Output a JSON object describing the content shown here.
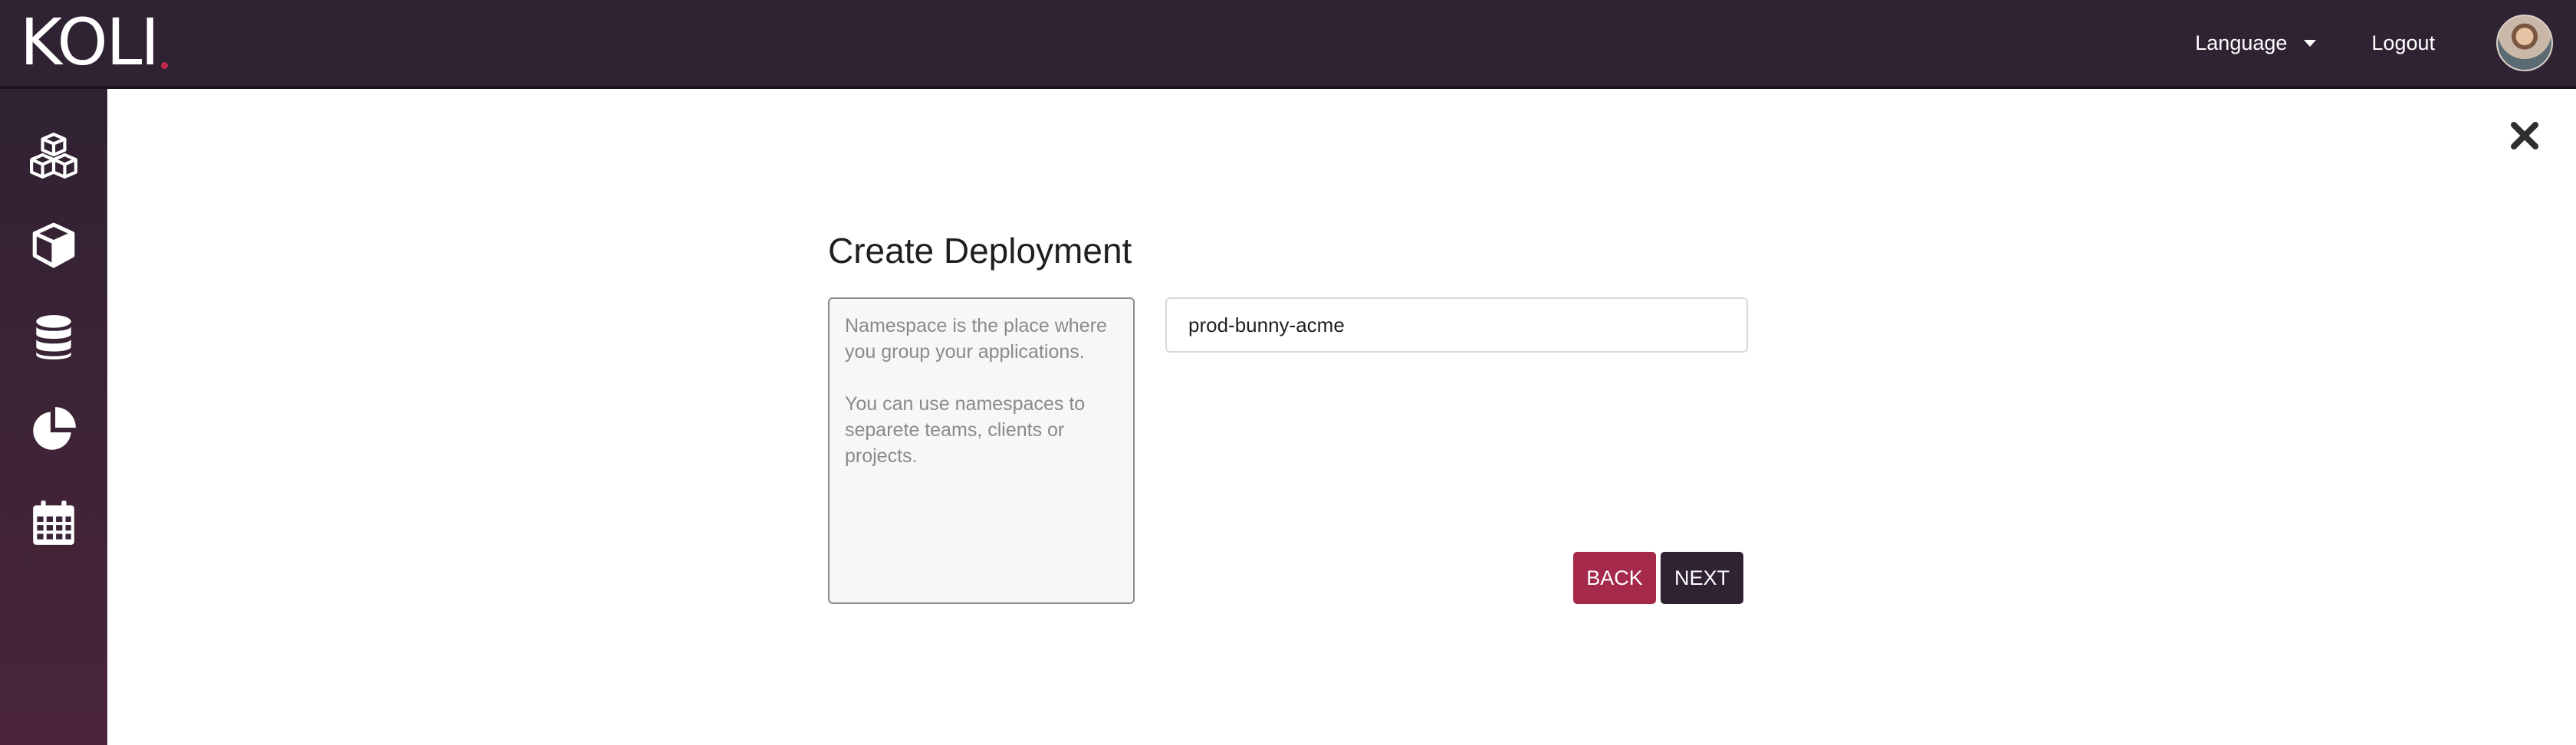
{
  "header": {
    "logo_text": "KOLI",
    "language_label": "Language",
    "logout_label": "Logout"
  },
  "sidebar": {
    "items": [
      {
        "icon": "cubes-icon"
      },
      {
        "icon": "cube-icon"
      },
      {
        "icon": "database-icon"
      },
      {
        "icon": "pie-chart-icon"
      },
      {
        "icon": "calendar-icon"
      }
    ]
  },
  "main": {
    "title": "Create Deployment",
    "help_text_1": "Namespace is the place where you group your applications.",
    "help_text_2": "You can use namespaces to separete teams, clients or projects.",
    "namespace_value": "prod-bunny-acme",
    "back_label": "BACK",
    "next_label": "NEXT"
  },
  "colors": {
    "topbar": "#2f2233",
    "back_button": "#a5294b",
    "next_button": "#2f2233",
    "accent_dot": "#c2274f"
  }
}
